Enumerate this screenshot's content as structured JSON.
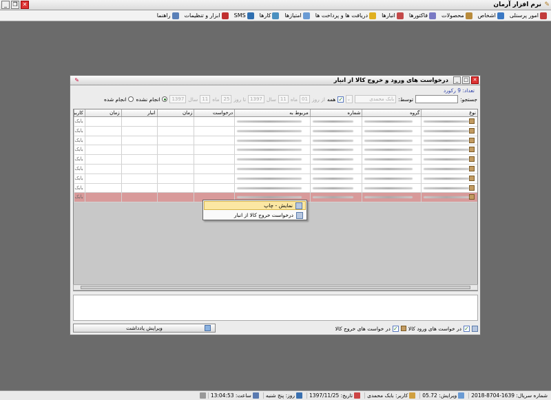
{
  "app": {
    "title": "نرم افزار آرمان"
  },
  "menu": [
    {
      "label": "امور پرسنلی",
      "icon": "personnel-icon",
      "color": "#c23b3b"
    },
    {
      "label": "اشخاص",
      "icon": "people-icon",
      "color": "#3a78c4"
    },
    {
      "label": "محصولات",
      "icon": "products-icon",
      "color": "#b98b3b"
    },
    {
      "label": "فاکتورها",
      "icon": "invoices-icon",
      "color": "#7a7ac4"
    },
    {
      "label": "انبارها",
      "icon": "warehouses-icon",
      "color": "#c44a4a"
    },
    {
      "label": "دریافت ها و پرداخت ها",
      "icon": "payments-icon",
      "color": "#e0b020"
    },
    {
      "label": "امتیازها",
      "icon": "points-icon",
      "color": "#6a9bd4"
    },
    {
      "label": "کارها",
      "icon": "tasks-icon",
      "color": "#4a90c0"
    },
    {
      "label": "SMS",
      "icon": "sms-icon",
      "color": "#2f6fb0"
    },
    {
      "label": "ابزار و تنظیمات",
      "icon": "tools-icon",
      "color": "#c03030"
    },
    {
      "label": "راهنما",
      "icon": "help-icon",
      "color": "#5a80b8"
    }
  ],
  "dialog": {
    "title": "درخواست های ورود و خروج کالا از انبار",
    "count_label": "تعداد: 9 رکورد",
    "filter": {
      "search_label": "جستجو:",
      "by_label": "توسط:",
      "by_value": "بابک محمدی",
      "all_label": "همه",
      "from_day_label": "از روز",
      "from_day": "01",
      "month_label": "ماه",
      "from_month": "11",
      "year_label": "سال",
      "from_year": "1397",
      "to_day_label": "تا روز",
      "to_day": "25",
      "to_month": "11",
      "to_year": "1397",
      "done_label": "انجام شده",
      "not_done_label": "انجام نشده"
    },
    "columns": [
      "نوع",
      "گروه",
      "شماره",
      "مربوط به",
      "درخواست",
      "زمان",
      "انبار",
      "زمان",
      "کاربر"
    ],
    "rows": [
      {
        "user": "بابک"
      },
      {
        "user": "بابک"
      },
      {
        "user": "بابک"
      },
      {
        "user": "بابک"
      },
      {
        "user": "بابک"
      },
      {
        "user": "بابک"
      },
      {
        "user": "بابک"
      },
      {
        "user": "بابک"
      },
      {
        "user": "بابک",
        "selected": true
      }
    ],
    "context_menu": [
      {
        "label": "نمایش - چاپ"
      },
      {
        "label": "درخواست خروج کالا از انبار"
      }
    ],
    "bottom": {
      "in_requests_label": "در خواست های ورود کالا",
      "out_requests_label": "در خواست های خروج کالا",
      "edit_note_label": "ویرایش یادداشت"
    }
  },
  "status": {
    "serial": "شماره سریال: 1639-8704-2018",
    "version": "ویرایش: 05.72",
    "user": "کاربر: بابک محمدی",
    "date": "تاریخ: 1397/11/25",
    "day": "روز: پنج شنبه",
    "time": "ساعت: 13:04:53"
  }
}
